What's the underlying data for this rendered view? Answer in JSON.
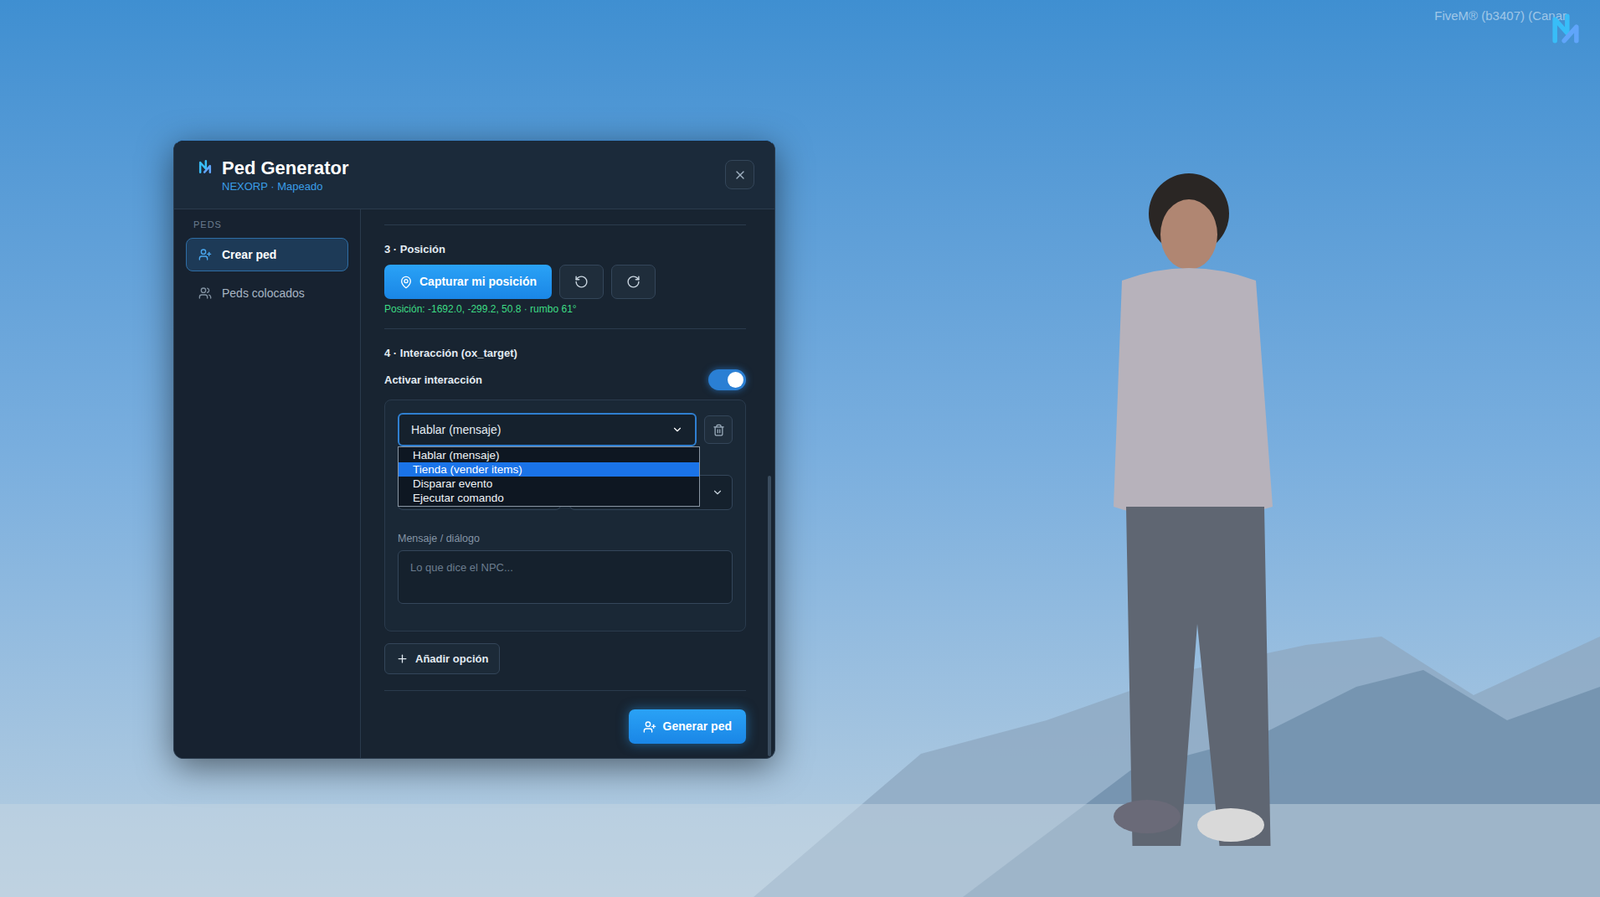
{
  "status": "FiveM® (b3407) (Canar",
  "window": {
    "title": "Ped Generator",
    "subtitle": "NEXORP · Mapeado"
  },
  "sidebar": {
    "heading": "PEDS",
    "items": [
      {
        "label": "Crear ped",
        "selected": true
      },
      {
        "label": "Peds colocados",
        "selected": false
      }
    ]
  },
  "position": {
    "heading": "3 · Posición",
    "capture_button": "Capturar mi posición",
    "reading": "Posición: -1692.0, -299.2, 50.8 · rumbo 61°"
  },
  "interaction": {
    "heading": "4 · Interacción (ox_target)",
    "toggle": {
      "label": "Activar interacción",
      "on": true
    },
    "options": [
      {
        "type": "Hablar (mensaje)",
        "menu_open": true,
        "menu": [
          {
            "label": "Hablar (mensaje)",
            "selected": false
          },
          {
            "label": "Tienda (vender items)",
            "selected": true
          },
          {
            "label": "Disparar evento",
            "selected": false
          },
          {
            "label": "Ejecutar comando",
            "selected": false
          }
        ],
        "message_label": "Mensaje / diálogo",
        "message_placeholder": "Lo que dice el NPC..."
      }
    ],
    "add_button": "Añadir opción"
  },
  "generate_button": "Generar ped"
}
